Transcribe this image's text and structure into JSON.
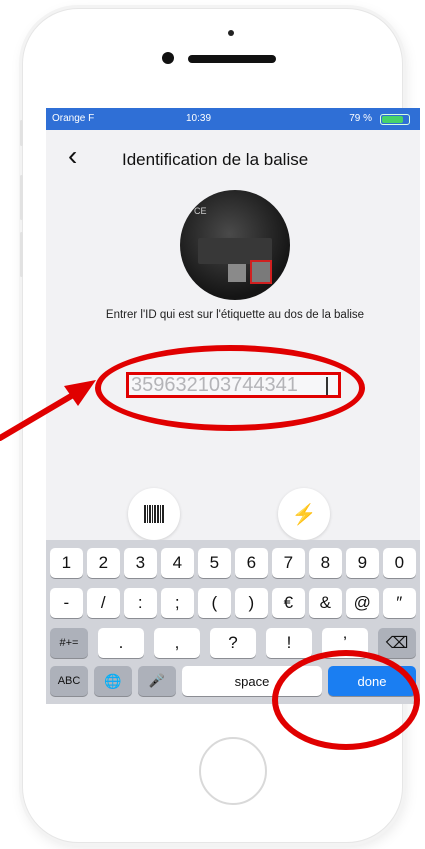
{
  "status_bar": {
    "carrier": "Orange F",
    "time": "10:39",
    "battery": "79 %",
    "battery_level": 0.79
  },
  "nav": {
    "back_label": "‹",
    "title": "Identification de la balise"
  },
  "photo": {
    "ce_mark": "CE"
  },
  "instruction": "Entrer l'ID qui est sur l'étiquette au dos de la balise",
  "id_field": {
    "value": "359632103744341"
  },
  "tools": {
    "barcode_icon": "barcode-icon",
    "flash_icon": "flash-icon",
    "flash_glyph": "⚡"
  },
  "keyboard": {
    "row1": [
      "1",
      "2",
      "3",
      "4",
      "5",
      "6",
      "7",
      "8",
      "9",
      "0"
    ],
    "row2": [
      "-",
      "/",
      ":",
      ";",
      "(",
      ")",
      "€",
      "&",
      "@",
      "″"
    ],
    "row3_left": "#+=",
    "row3": [
      ".",
      ",",
      "?",
      "!",
      "’"
    ],
    "backspace": "⌫",
    "abc": "ABC",
    "globe": "🌐",
    "mic": "🎤",
    "space": "space",
    "done": "done"
  },
  "colors": {
    "annotation": "#e00000",
    "done_key": "#1a7ef2",
    "status_bar": "#2f6fd6"
  }
}
